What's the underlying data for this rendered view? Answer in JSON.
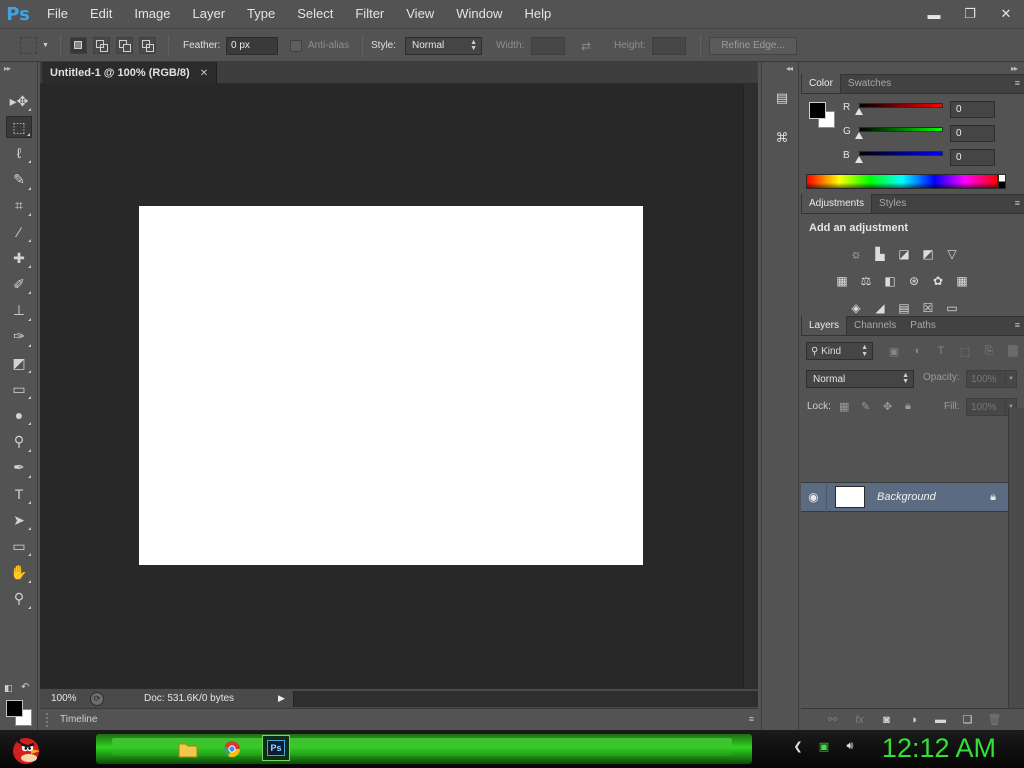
{
  "app": {
    "logo": "Ps",
    "title": "Adobe Photoshop"
  },
  "menu": [
    "File",
    "Edit",
    "Image",
    "Layer",
    "Type",
    "Select",
    "Filter",
    "View",
    "Window",
    "Help"
  ],
  "window_controls": {
    "minimize": "▬",
    "restore": "❐",
    "close": "✕"
  },
  "options_bar": {
    "feather_label": "Feather:",
    "feather_value": "0 px",
    "antialias_label": "Anti-alias",
    "style_label": "Style:",
    "style_value": "Normal",
    "width_label": "Width:",
    "height_label": "Height:",
    "refine_edge_label": "Refine Edge..."
  },
  "tools": [
    {
      "name": "move-tool",
      "icon": "move-icon",
      "glyph": "▸✥"
    },
    {
      "name": "rectangular-marquee-tool",
      "icon": "marquee-icon",
      "glyph": "⬚",
      "active": true
    },
    {
      "name": "lasso-tool",
      "icon": "lasso-icon",
      "glyph": "ℓ"
    },
    {
      "name": "quick-selection-tool",
      "icon": "quick-selection-icon",
      "glyph": "✎"
    },
    {
      "name": "crop-tool",
      "icon": "crop-icon",
      "glyph": "⌗"
    },
    {
      "name": "eyedropper-tool",
      "icon": "eyedropper-icon",
      "glyph": "⁄"
    },
    {
      "name": "spot-healing-tool",
      "icon": "bandage-icon",
      "glyph": "✚"
    },
    {
      "name": "brush-tool",
      "icon": "brush-icon",
      "glyph": "✐"
    },
    {
      "name": "clone-stamp-tool",
      "icon": "stamp-icon",
      "glyph": "⊥"
    },
    {
      "name": "history-brush-tool",
      "icon": "history-brush-icon",
      "glyph": "✑"
    },
    {
      "name": "eraser-tool",
      "icon": "eraser-icon",
      "glyph": "◩"
    },
    {
      "name": "gradient-tool",
      "icon": "gradient-icon",
      "glyph": "▭"
    },
    {
      "name": "blur-tool",
      "icon": "drop-icon",
      "glyph": "●"
    },
    {
      "name": "dodge-tool",
      "icon": "dodge-icon",
      "glyph": "⚲"
    },
    {
      "name": "pen-tool",
      "icon": "pen-icon",
      "glyph": "✒"
    },
    {
      "name": "type-tool",
      "icon": "type-icon",
      "glyph": "T"
    },
    {
      "name": "path-selection-tool",
      "icon": "path-selection-icon",
      "glyph": "➤"
    },
    {
      "name": "rectangle-tool",
      "icon": "rectangle-icon",
      "glyph": "▭"
    },
    {
      "name": "hand-tool",
      "icon": "hand-icon",
      "glyph": "✋"
    },
    {
      "name": "zoom-tool",
      "icon": "zoom-icon",
      "glyph": "⚲"
    }
  ],
  "colors": {
    "foreground": "#000000",
    "background": "#ffffff",
    "layer_highlight": "#5b6c82",
    "clock": "#33e033"
  },
  "document": {
    "tab_title": "Untitled-1 @ 100% (RGB/8)",
    "close_glyph": "✕",
    "zoom": "100%",
    "doc_info": "Doc: 531.6K/0 bytes"
  },
  "timeline": {
    "label": "Timeline"
  },
  "color_panel": {
    "tabs": [
      "Color",
      "Swatches"
    ],
    "channels": [
      {
        "label": "R",
        "value": "0"
      },
      {
        "label": "G",
        "value": "0"
      },
      {
        "label": "B",
        "value": "0"
      }
    ]
  },
  "adjustments_panel": {
    "tabs": [
      "Adjustments",
      "Styles"
    ],
    "title": "Add an adjustment",
    "icons": [
      [
        "brightness-contrast-icon",
        "levels-icon",
        "curves-icon",
        "exposure-icon",
        "vibrance-icon"
      ],
      [
        "hue-saturation-icon",
        "color-balance-icon",
        "black-white-icon",
        "photo-filter-icon",
        "channel-mixer-icon",
        "color-lookup-icon"
      ],
      [
        "invert-icon",
        "posterize-icon",
        "threshold-icon",
        "selective-color-icon",
        "gradient-map-icon"
      ]
    ],
    "glyphs": [
      [
        "☼",
        "▙",
        "◪",
        "◩",
        "▽"
      ],
      [
        "▦",
        "⚖",
        "◧",
        "⊛",
        "✿",
        "▦"
      ],
      [
        "◈",
        "◢",
        "▤",
        "☒",
        "▭"
      ]
    ]
  },
  "layers_panel": {
    "tabs": [
      "Layers",
      "Channels",
      "Paths"
    ],
    "filter_label": "⚲ Kind",
    "blend_mode": "Normal",
    "opacity_label": "Opacity:",
    "opacity_value": "100%",
    "lock_label": "Lock:",
    "fill_label": "Fill:",
    "fill_value": "100%",
    "layers": [
      {
        "name": "Background",
        "visible": true,
        "locked": true
      }
    ]
  },
  "taskbar": {
    "clock": "12:12 AM",
    "apps": [
      "folder-icon",
      "chrome-icon",
      "photoshop-icon"
    ],
    "photoshop_label": "Ps"
  }
}
